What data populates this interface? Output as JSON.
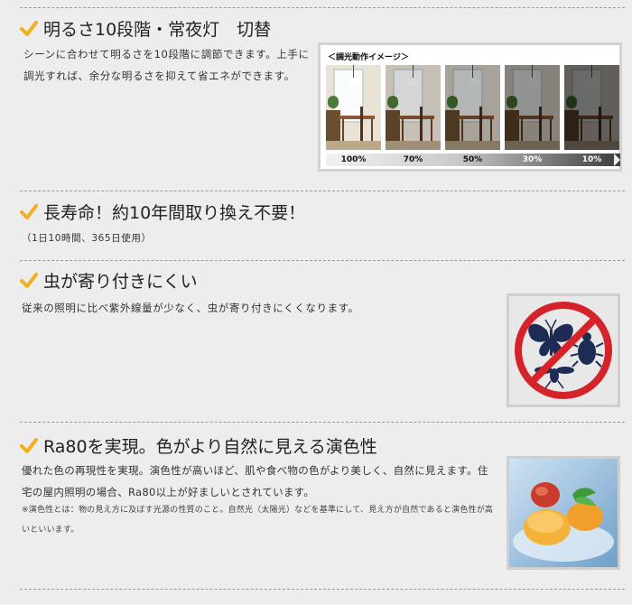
{
  "sections": [
    {
      "heading": "明るさ10段階・常夜灯　切替",
      "body": [
        "シーンに合わせて明るさを10段階に調節できます。上手に",
        "調光すれば、余分な明るさを抑えて省エネができます。"
      ],
      "image": {
        "title": "＜調光動作イメージ＞",
        "levels": [
          {
            "label": "100%",
            "dim": 0.0
          },
          {
            "label": "70%",
            "dim": 0.15
          },
          {
            "label": "50%",
            "dim": 0.28
          },
          {
            "label": "30%",
            "dim": 0.42
          },
          {
            "label": "10%",
            "dim": 0.58
          }
        ]
      }
    },
    {
      "heading": "長寿命！約10年間取り換え不要！",
      "note": "（1日10時間、365日使用）"
    },
    {
      "heading": "虫が寄り付きにくい",
      "body": [
        "従来の照明に比べ紫外線量が少なく、虫が寄り付きにくくなります。"
      ],
      "icon": "no-insects-icon"
    },
    {
      "heading": "Ra80を実現。色がより自然に見える演色性",
      "body": [
        "優れた色の再現性を実現。演色性が高いほど、肌や食べ物の色がより美しく、自然に見えます。住",
        "宅の屋内照明の場合、Ra80以上が好ましいとされています。"
      ],
      "footnote": [
        "※演色性とは：物の見え方に及ぼす光源の性質のこと。自然光（太陽光）などを基準にして、見え方が自然であると演色性が高",
        "いといいます。"
      ],
      "icon": "dessert-photo"
    }
  ],
  "colors": {
    "check": "#f2b01e",
    "background": "#ededed",
    "prohibit": "#d4232a",
    "insect": "#1d2c55"
  }
}
